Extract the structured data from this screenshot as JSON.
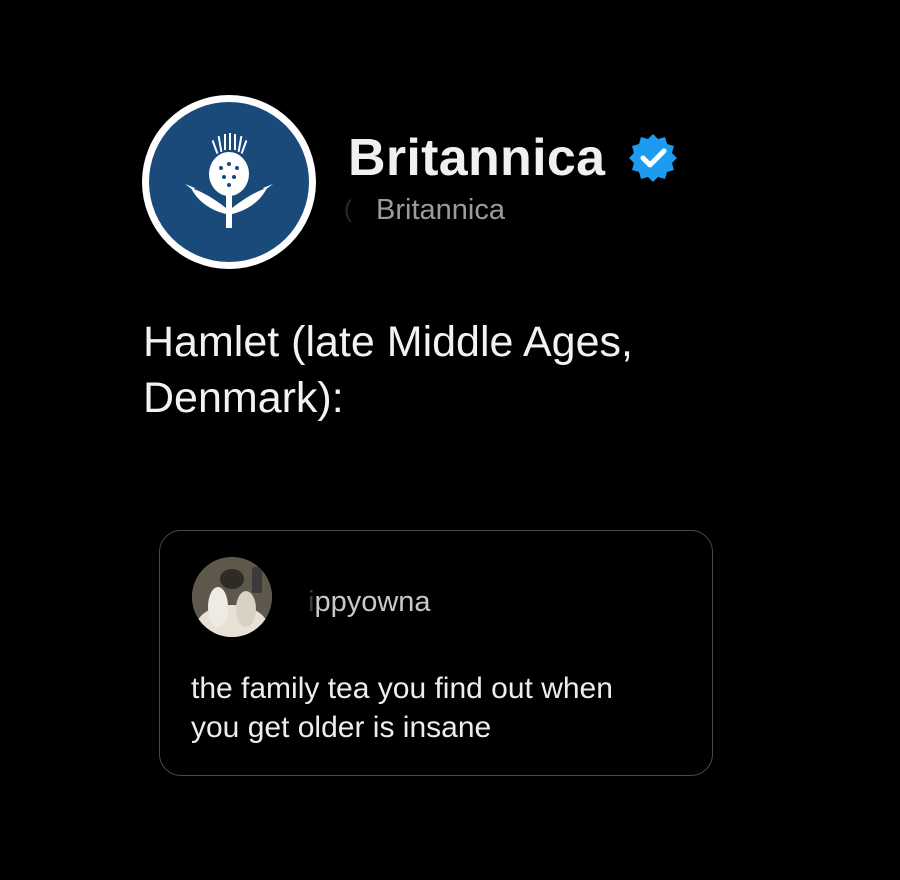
{
  "account": {
    "display_name": "Britannica",
    "handle": "Britannica",
    "verified": true,
    "avatar_icon": "thistle-logo-icon",
    "avatar_color": "#1a4a7a",
    "verified_color": "#1d9bf0"
  },
  "post": {
    "text": "Hamlet (late Middle Ages,\nDenmark):"
  },
  "quoted_reply": {
    "username_faded": "i",
    "username": "ppyowna",
    "text": "the family tea you find out when\nyou get older is insane",
    "avatar_icon": "user-photo-avatar"
  }
}
